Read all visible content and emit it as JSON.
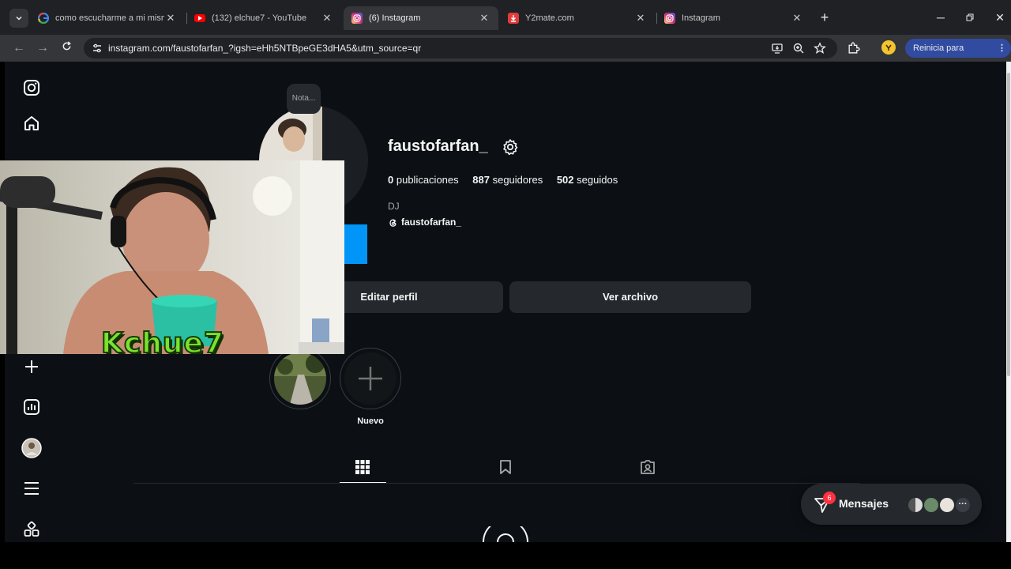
{
  "browser": {
    "tabs": [
      {
        "title": "como escucharme a mi mismo",
        "favicon": "google-icon"
      },
      {
        "title": "(132) elchue7 - YouTube",
        "favicon": "youtube-icon"
      },
      {
        "title": "(6) Instagram",
        "favicon": "instagram-icon",
        "active": true
      },
      {
        "title": "Y2mate.com",
        "favicon": "y2mate-icon"
      },
      {
        "title": "Instagram",
        "favicon": "instagram-icon"
      }
    ],
    "url": "instagram.com/faustofarfan_?igsh=eHh5NTBpeGE3dHA5&utm_source=qr",
    "update_label": "Reinicia para actualizar"
  },
  "profile": {
    "note": "Nota...",
    "username": "faustofarfan_",
    "posts_count": "0",
    "posts_label": "publicaciones",
    "followers_count": "887",
    "followers_label": "seguidores",
    "following_count": "502",
    "following_label": "seguidos",
    "category": "DJ",
    "threads_handle": "faustofarfan_",
    "edit_profile_label": "Editar perfil",
    "archive_label": "Ver archivo",
    "new_highlight_label": "Nuevo"
  },
  "messages": {
    "label": "Mensajes",
    "badge_count": "6"
  },
  "overlay": {
    "logo_text": "Kchue7"
  },
  "colors": {
    "page_bg": "#0c1014",
    "accent_blue": "#0095f6",
    "badge_red": "#ff3040",
    "logo_green": "#7be22f"
  }
}
